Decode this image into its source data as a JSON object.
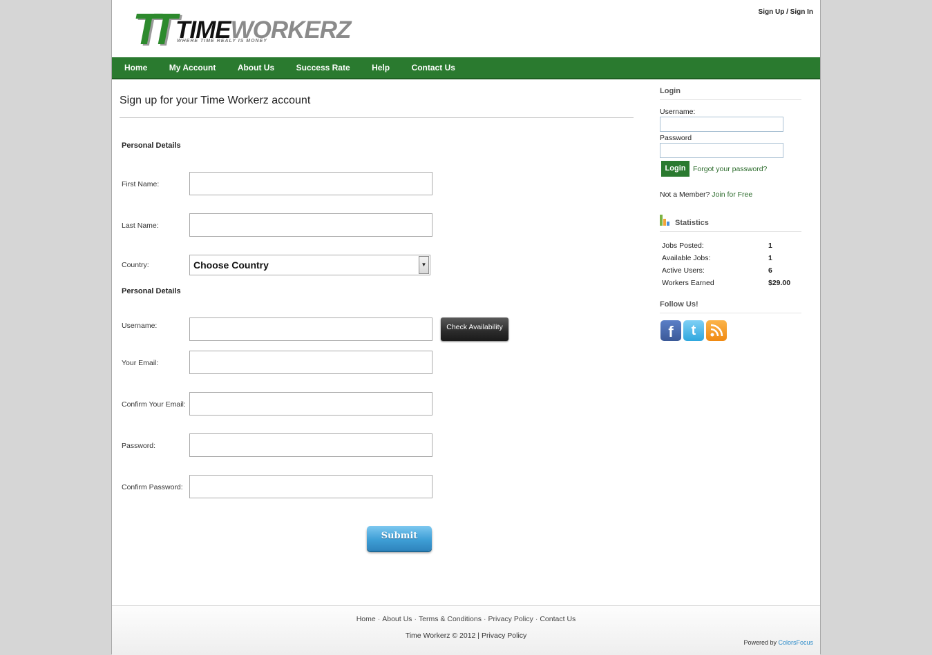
{
  "header": {
    "logo_text_1": "TIME",
    "logo_text_2": "WORKERZ",
    "logo_tagline": "WHERE TIME REALY IS MONEY",
    "signup_link": "Sign Up",
    "signin_separator": "/",
    "signin_link": "Sign In"
  },
  "nav": {
    "items": [
      "Home",
      "My Account",
      "About Us",
      "Success Rate",
      "Help",
      "Contact Us"
    ]
  },
  "main": {
    "title": "Sign up for your Time Workerz account",
    "section_personal": "Personal Details",
    "first_name_label": "First Name:",
    "last_name_label": "Last Name:",
    "country_label": "Country:",
    "country_value": "Choose Country",
    "section_personal_2": "Personal Details",
    "username_label": "Username:",
    "check_button": "Check Availability",
    "email_label": "Your Email:",
    "confirm_email_label": "Confirm Your Email:",
    "password_label": "Password:",
    "confirm_password_label": "Confirm Password:",
    "submit_button": "Submit"
  },
  "sidebar": {
    "login_heading": "Login",
    "username_label": "Username:",
    "password_label": "Password",
    "login_button": "Login",
    "forgot_link": "Forgot your password?",
    "not_member": "Not a Member?",
    "join_link": "Join for Free",
    "stats_heading": "Statistics",
    "stats": [
      {
        "label": "Jobs Posted:",
        "value": "1"
      },
      {
        "label": "Available Jobs:",
        "value": "1"
      },
      {
        "label": "Active Users:",
        "value": "6"
      },
      {
        "label": "Workers Earned",
        "value": "$29.00"
      }
    ],
    "follow_heading": "Follow Us!",
    "social_icons": [
      "facebook-icon",
      "twitter-icon",
      "rss-icon"
    ]
  },
  "footer": {
    "links": [
      "Home",
      "About Us",
      "Terms & Conditions",
      "Privacy Policy",
      "Contact Us"
    ],
    "link_separator": "·",
    "copyright": "Time Workerz © 2012 |",
    "copyright_link": "Privacy Policy",
    "powered_by": "Powered by",
    "powered_brand": "ColorsFocus"
  },
  "colors": {
    "nav_green": "#2a7a2f",
    "submit_blue": "#3f9fd6",
    "link_green": "#2a6a2a"
  }
}
